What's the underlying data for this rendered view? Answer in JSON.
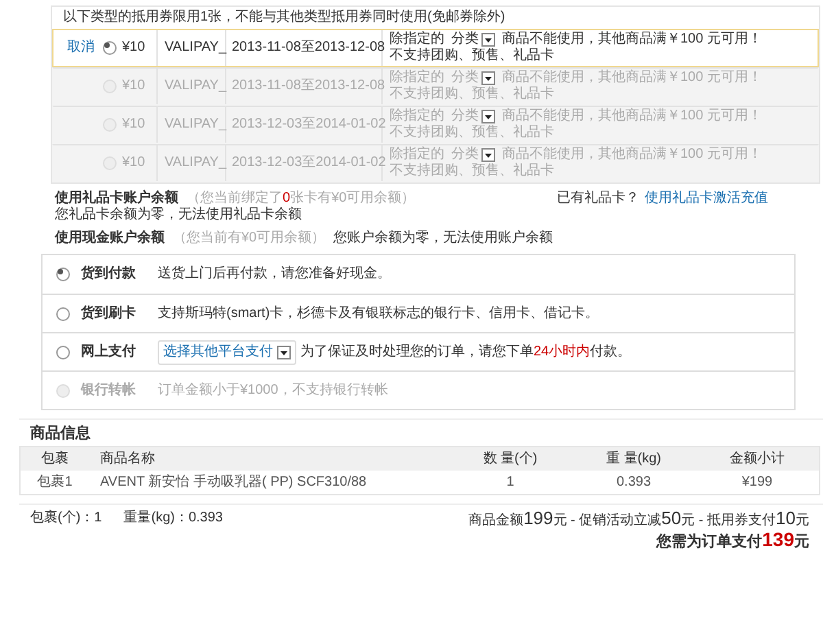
{
  "coupons": {
    "notice": "以下类型的抵用券限用1张，不能与其他类型抵用券同时使用(免邮券除外)",
    "rows": [
      {
        "action": "取消",
        "selected": true,
        "disabled": false,
        "amount": "¥10",
        "code": "VALIPAY_",
        "period": "2013-11-08至2013-12-08",
        "scope_before": "除指定的",
        "scope_select": "分类",
        "scope_after": "商品不能使用，其他商品满￥100 元可用！",
        "restriction": "不支持团购、预售、礼品卡"
      },
      {
        "selected": false,
        "disabled": true,
        "amount": "¥10",
        "code": "VALIPAY_",
        "period": "2013-11-08至2013-12-08",
        "scope_before": "除指定的",
        "scope_select": "分类",
        "scope_after": "商品不能使用，其他商品满￥100 元可用！",
        "restriction": "不支持团购、预售、礼品卡"
      },
      {
        "selected": false,
        "disabled": true,
        "amount": "¥10",
        "code": "VALIPAY_",
        "period": "2013-12-03至2014-01-02",
        "scope_before": "除指定的",
        "scope_select": "分类",
        "scope_after": "商品不能使用，其他商品满￥100 元可用！",
        "restriction": "不支持团购、预售、礼品卡"
      },
      {
        "selected": false,
        "disabled": true,
        "amount": "¥10",
        "code": "VALIPAY_",
        "period": "2013-12-03至2014-01-02",
        "scope_before": "除指定的",
        "scope_select": "分类",
        "scope_after": "商品不能使用，其他商品满￥100 元可用！",
        "restriction": "不支持团购、预售、礼品卡"
      }
    ]
  },
  "gift_card": {
    "title": "使用礼品卡账户余额",
    "hint": [
      {
        "kind": "plain",
        "text": "（您当前绑定了"
      },
      {
        "kind": "highlight",
        "text": "0"
      },
      {
        "kind": "plain",
        "text": "张卡有¥0可用余额）"
      }
    ],
    "message": "您礼品卡余额为零，无法使用礼品卡余额",
    "question": "已有礼品卡？",
    "link": "使用礼品卡激活充值"
  },
  "cash_account": {
    "title": "使用现金账户余额",
    "hint": [
      {
        "kind": "plain",
        "text": "（您当前有¥0可用余额）"
      }
    ],
    "message": "您账户余额为零，无法使用账户余额"
  },
  "payment_methods": [
    {
      "label": "货到付款",
      "selected": true,
      "disabled": false,
      "note": [
        {
          "kind": "plain",
          "text": "送货上门后再付款，请您准备好现金。"
        }
      ]
    },
    {
      "label": "货到刷卡",
      "selected": false,
      "disabled": false,
      "note": [
        {
          "kind": "plain",
          "text": "支持斯玛特(smart)卡，杉德卡及有银联标志的银行卡、信用卡、借记卡。"
        }
      ]
    },
    {
      "label": "网上支付",
      "selected": false,
      "disabled": false,
      "select": "选择其他平台支付",
      "note": [
        {
          "kind": "plain",
          "text": "为了保证及时处理您的订单，请您下单"
        },
        {
          "kind": "highlight",
          "text": "24小时内"
        },
        {
          "kind": "plain",
          "text": "付款。"
        }
      ]
    },
    {
      "label": "银行转帐",
      "selected": false,
      "disabled": true,
      "note": [
        {
          "kind": "plain",
          "text": "订单金额小于¥1000，不支持银行转帐"
        }
      ]
    }
  ],
  "products": {
    "title": "商品信息",
    "columns": [
      "包裹",
      "商品名称",
      "数 量(个)",
      "重 量(kg)",
      "金额小计"
    ],
    "rows": [
      [
        "包裹1",
        "AVENT 新安怡 手动吸乳器( PP) SCF310/88",
        "1",
        "0.393",
        "¥199"
      ]
    ]
  },
  "summary": {
    "packages": "包裹(个)：1",
    "weight": "重量(kg)：0.393",
    "breakdown": [
      {
        "kind": "plain",
        "text": "商品金额"
      },
      {
        "kind": "number",
        "text": "199"
      },
      {
        "kind": "plain",
        "text": "元 - 促销活动立减"
      },
      {
        "kind": "number",
        "text": "50"
      },
      {
        "kind": "plain",
        "text": "元 - 抵用券支付"
      },
      {
        "kind": "number",
        "text": "10"
      },
      {
        "kind": "plain",
        "text": "元"
      }
    ],
    "total": [
      {
        "kind": "plain",
        "text": "您需为订单支付"
      },
      {
        "kind": "highlight-number",
        "text": "139"
      },
      {
        "kind": "plain",
        "text": "元"
      }
    ]
  }
}
